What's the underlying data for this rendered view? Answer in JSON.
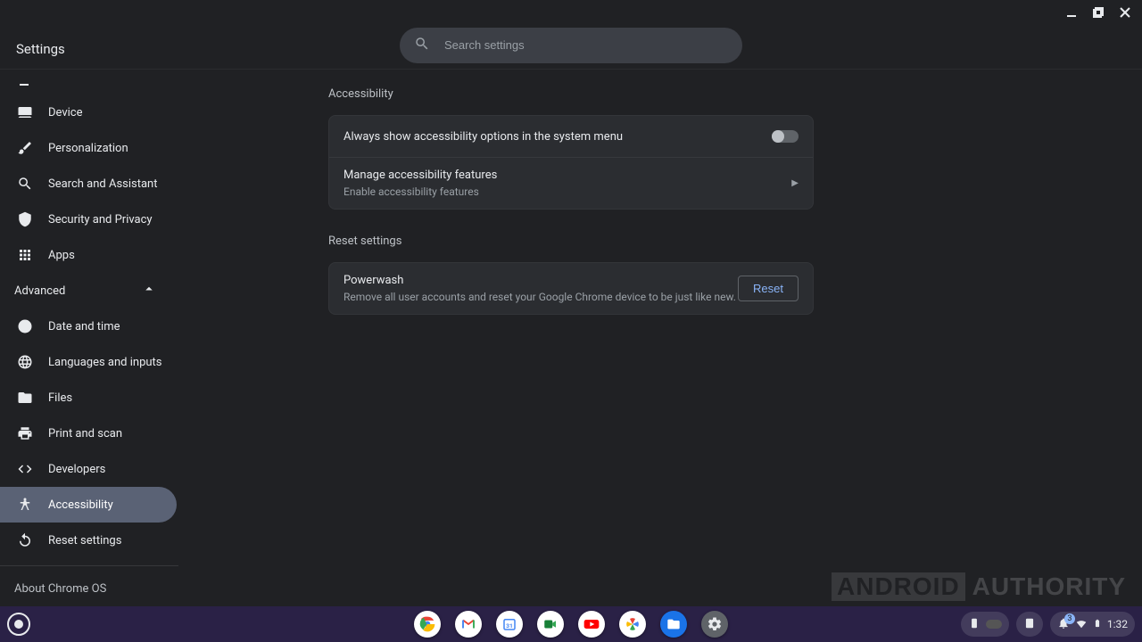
{
  "window": {
    "title": "Settings"
  },
  "search": {
    "placeholder": "Search settings"
  },
  "sidebar": {
    "main_items": [
      {
        "label": "Device",
        "icon": "laptop-icon"
      },
      {
        "label": "Personalization",
        "icon": "brush-icon"
      },
      {
        "label": "Search and Assistant",
        "icon": "search-icon"
      },
      {
        "label": "Security and Privacy",
        "icon": "shield-icon"
      },
      {
        "label": "Apps",
        "icon": "apps-grid-icon"
      }
    ],
    "advanced_label": "Advanced",
    "advanced_items": [
      {
        "label": "Date and time",
        "icon": "clock-icon"
      },
      {
        "label": "Languages and inputs",
        "icon": "globe-icon"
      },
      {
        "label": "Files",
        "icon": "folder-icon"
      },
      {
        "label": "Print and scan",
        "icon": "printer-icon"
      },
      {
        "label": "Developers",
        "icon": "code-icon"
      },
      {
        "label": "Accessibility",
        "icon": "accessibility-icon",
        "selected": true
      },
      {
        "label": "Reset settings",
        "icon": "reset-icon"
      }
    ],
    "about_label": "About Chrome OS"
  },
  "main": {
    "accessibility_header": "Accessibility",
    "always_show_label": "Always show accessibility options in the system menu",
    "manage_title": "Manage accessibility features",
    "manage_sub": "Enable accessibility features",
    "reset_header": "Reset settings",
    "powerwash_title": "Powerwash",
    "powerwash_sub": "Remove all user accounts and reset your Google Chrome device to be just like new.",
    "reset_button": "Reset"
  },
  "shelf": {
    "apps": [
      {
        "name": "chrome-icon",
        "bg": "#fff",
        "glyph_color": "#ea4335"
      },
      {
        "name": "gmail-icon",
        "bg": "#fff",
        "glyph_color": "#ea4335"
      },
      {
        "name": "calendar-icon",
        "bg": "#fff",
        "glyph_color": "#4285f4"
      },
      {
        "name": "meet-icon",
        "bg": "#fff",
        "glyph_color": "#188038"
      },
      {
        "name": "youtube-icon",
        "bg": "#fff",
        "glyph_color": "#ff0000"
      },
      {
        "name": "photos-icon",
        "bg": "#fff",
        "glyph_color": "#fbbc04"
      },
      {
        "name": "files-icon",
        "bg": "#1a73e8",
        "glyph_color": "#fff"
      },
      {
        "name": "settings-icon",
        "bg": "#5f6368",
        "glyph_color": "#e8eaed"
      }
    ],
    "notification_badge": "3",
    "time": "1:32"
  },
  "watermark": {
    "boxed": "ANDROID",
    "rest": "AUTHORITY"
  }
}
